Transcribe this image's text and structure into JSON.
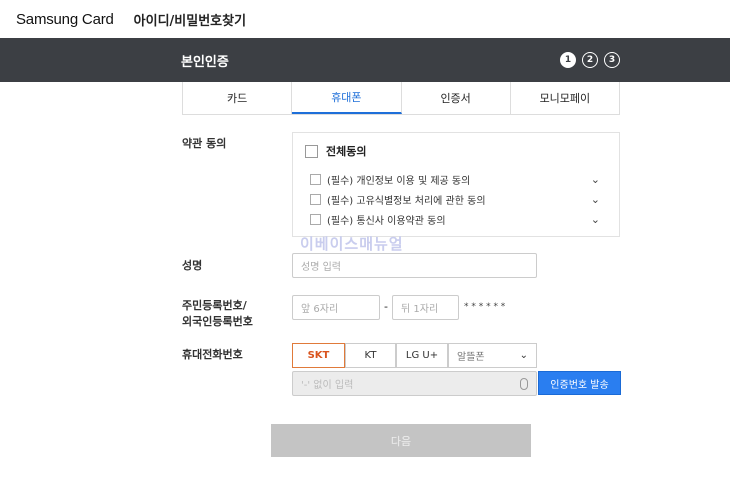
{
  "header": {
    "brand": "Samsung Card",
    "title": "아이디/비밀번호찾기"
  },
  "section": {
    "title": "본인인증",
    "steps": [
      "1",
      "2",
      "3"
    ],
    "active_step": 1
  },
  "tabs": [
    {
      "label": "카드"
    },
    {
      "label": "휴대폰",
      "active": true
    },
    {
      "label": "인증서"
    },
    {
      "label": "모니모페이"
    }
  ],
  "terms": {
    "label": "약관 동의",
    "all": "전체동의",
    "items": [
      {
        "label": "(필수) 개인정보 이용 및 제공 동의",
        "checked": false
      },
      {
        "label": "(필수) 고유식별정보 처리에 관한 동의",
        "checked": false
      },
      {
        "label": "(필수) 통신사 이용약관 동의",
        "checked": false
      }
    ]
  },
  "watermark": "이베이스매뉴얼",
  "name": {
    "label": "성명",
    "placeholder": "성명 입력"
  },
  "rrn": {
    "label1": "주민등록번호/",
    "label2": "외국인등록번호",
    "front_placeholder": "앞 6자리",
    "dash": "-",
    "back_placeholder": "뒤 1자리",
    "mask": "* * * * * *"
  },
  "phone": {
    "label": "휴대전화번호",
    "carriers": [
      "SKT",
      "KT",
      "LG U+"
    ],
    "selected": "SKT",
    "mvno": "알뜰폰",
    "placeholder": "'-' 없이 입력",
    "send": "인증번호 발송"
  },
  "next": "다음",
  "colors": {
    "accent": "#2a7ef0",
    "header_bar": "#3c3f44",
    "selected_carrier": "#d9541e"
  }
}
